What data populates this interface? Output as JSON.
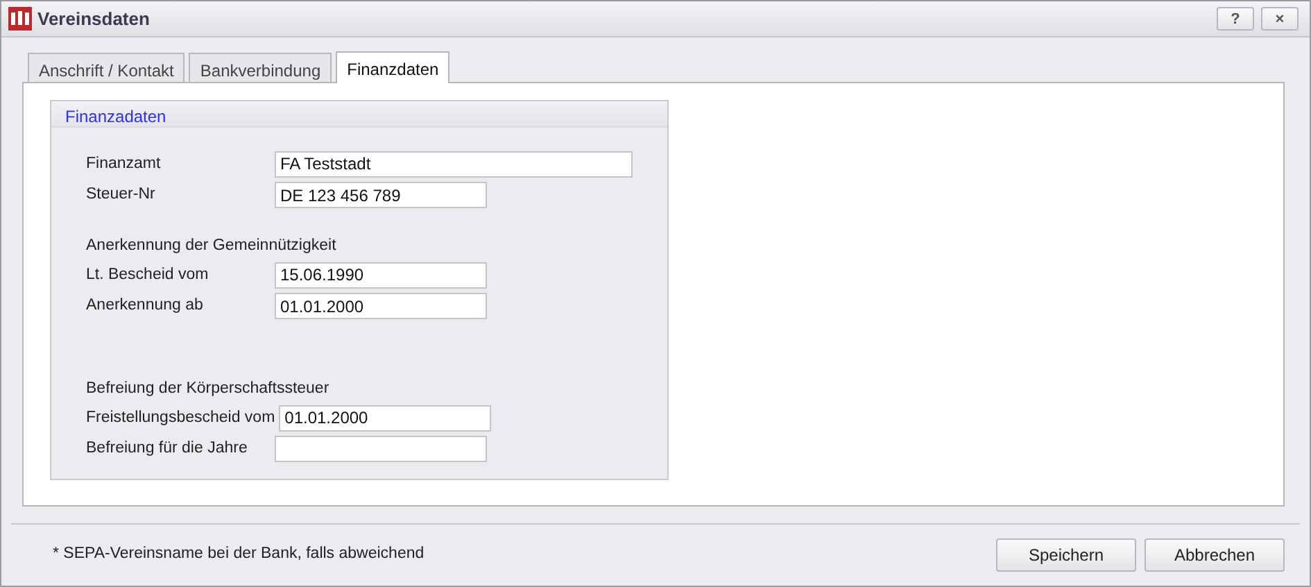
{
  "window": {
    "title": "Vereinsdaten",
    "buttons": [
      "?",
      "×"
    ]
  },
  "tabs": [
    {
      "label": "Anschrift / Kontakt",
      "selected": false
    },
    {
      "label": "Bankverbindung",
      "selected": false
    },
    {
      "label": "Finanzdaten",
      "selected": true
    }
  ],
  "group": {
    "title": "Finanzadaten",
    "sections": [
      {
        "fields": [
          {
            "label": "Finanzamt",
            "value": "FA Teststadt",
            "wide": true
          },
          {
            "label": "Steuer-Nr",
            "value": "DE 123 456 789",
            "wide": false
          }
        ]
      },
      {
        "heading": "Anerkennung der Gemeinnützigkeit",
        "fields": [
          {
            "label": "Lt. Bescheid vom",
            "value": "15.06.1990",
            "wide": false
          },
          {
            "label": "Anerkennung ab",
            "value": "01.01.2000",
            "wide": false
          }
        ]
      },
      {
        "heading": "Befreiung der Körperschaftssteuer",
        "fields": [
          {
            "label": "Freistellungsbescheid vom",
            "value": "01.01.2000",
            "wide": false
          },
          {
            "label": "Befreiung für die Jahre",
            "wide": false
          }
        ]
      }
    ]
  },
  "footer": {
    "note": "* SEPA-Vereinsname bei der Bank, falls abweichend",
    "buttons": [
      "Speichern",
      "Abbrechen"
    ]
  }
}
